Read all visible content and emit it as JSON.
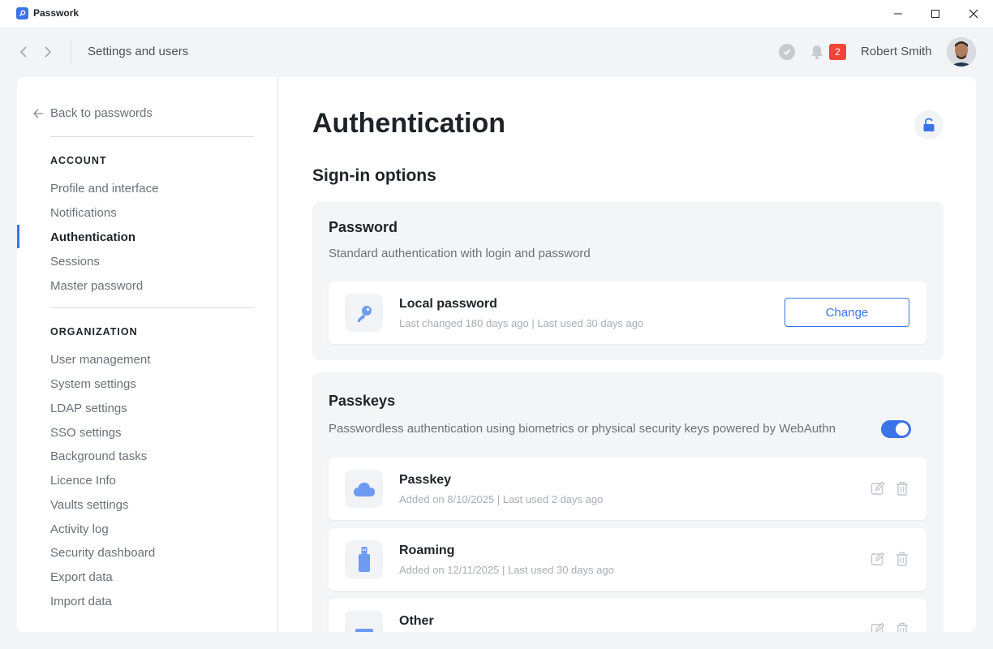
{
  "window": {
    "app_title": "Passwork"
  },
  "topbar": {
    "title": "Settings and users",
    "notification_count": "2",
    "user_name": "Robert Smith"
  },
  "sidebar": {
    "back_label": "Back to passwords",
    "account_heading": "ACCOUNT",
    "account_items": [
      {
        "label": "Profile and interface"
      },
      {
        "label": "Notifications"
      },
      {
        "label": "Authentication"
      },
      {
        "label": "Sessions"
      },
      {
        "label": "Master password"
      }
    ],
    "org_heading": "ORGANIZATION",
    "org_items": [
      {
        "label": "User management"
      },
      {
        "label": "System settings"
      },
      {
        "label": "LDAP settings"
      },
      {
        "label": "SSO settings"
      },
      {
        "label": "Background tasks"
      },
      {
        "label": "Licence Info"
      },
      {
        "label": "Vaults settings"
      },
      {
        "label": "Activity log"
      },
      {
        "label": "Security dashboard"
      },
      {
        "label": "Export data"
      },
      {
        "label": "Import data"
      }
    ]
  },
  "main": {
    "page_title": "Authentication",
    "section_title": "Sign-in options",
    "password_panel": {
      "title": "Password",
      "description": "Standard authentication with login and password",
      "row": {
        "title": "Local password",
        "meta": "Last changed 180 days ago | Last used 30 days ago",
        "button_label": "Change"
      }
    },
    "passkeys_panel": {
      "title": "Passkeys",
      "description": "Passwordless authentication using biometrics or physical security keys powered by WebAuthn",
      "toggle_on": true,
      "rows": [
        {
          "title": "Passkey",
          "meta": "Added on 8/10/2025 | Last used 2 days ago",
          "icon": "cloud-icon"
        },
        {
          "title": "Roaming",
          "meta": "Added on 12/11/2025 | Last used 30 days ago",
          "icon": "usb-key-icon"
        },
        {
          "title": "Other",
          "meta": "",
          "icon": "device-icon"
        }
      ]
    }
  },
  "colors": {
    "accent": "#3b73e8",
    "badge": "#f04438"
  }
}
